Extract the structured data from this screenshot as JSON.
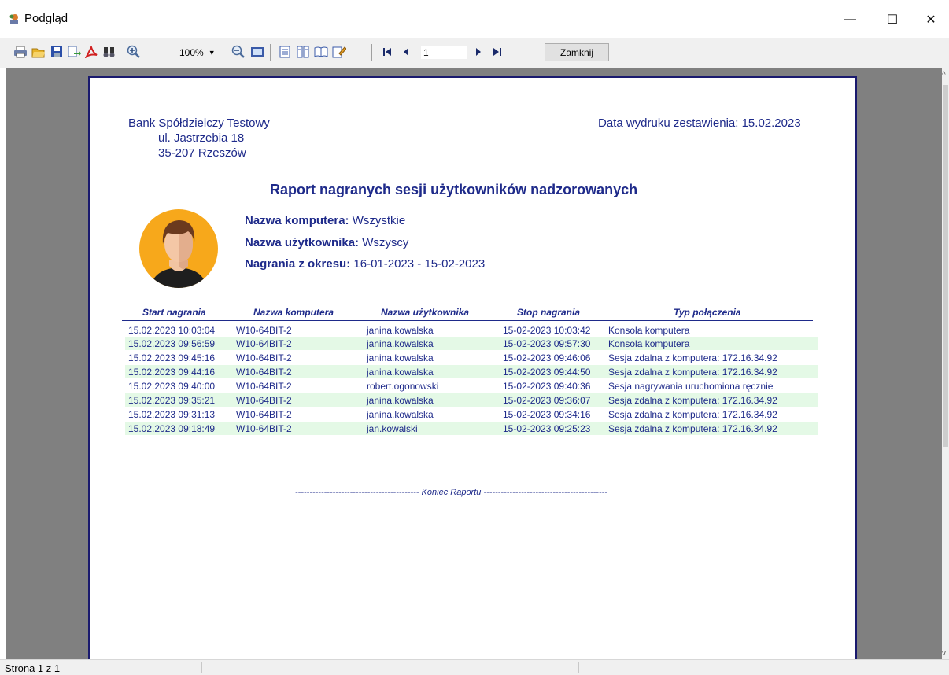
{
  "window": {
    "title": "Podgląd",
    "minimize_glyph": "—",
    "maximize_glyph": "☐",
    "close_glyph": "✕"
  },
  "toolbar": {
    "icons": [
      "print-icon",
      "open-icon",
      "save-icon",
      "export-icon",
      "pdf-icon",
      "find-icon",
      "zoom-in-icon",
      "zoom-out-icon",
      "fit-page-icon",
      "single-page-icon",
      "two-pages-icon",
      "book-view-icon",
      "edit-icon",
      "first-page-icon",
      "prev-page-icon",
      "next-page-icon",
      "last-page-icon"
    ],
    "zoom_value": "100%",
    "page_value": "1",
    "close_label": "Zamknij"
  },
  "report": {
    "bank_name": "Bank Spółdzielczy Testowy",
    "bank_street": "ul. Jastrzebia 18",
    "bank_city": "35-207 Rzeszów",
    "print_date": "Data wydruku zestawienia: 15.02.2023",
    "title": "Raport nagranych sesji użytkowników nadzorowanych",
    "computer_label": "Nazwa komputera:",
    "computer_value": "Wszystkie",
    "user_label": "Nazwa użytkownika:",
    "user_value": "Wszyscy",
    "period_label": "Nagrania z okresu:",
    "period_value": "16-01-2023 - 15-02-2023",
    "columns": [
      "Start nagrania",
      "Nazwa komputera",
      "Nazwa użytkownika",
      "Stop nagrania",
      "Typ połączenia"
    ],
    "rows": [
      [
        "15.02.2023 10:03:04",
        "W10-64BIT-2",
        "janina.kowalska",
        "15-02-2023 10:03:42",
        "Konsola komputera"
      ],
      [
        "15.02.2023 09:56:59",
        "W10-64BIT-2",
        "janina.kowalska",
        "15-02-2023 09:57:30",
        "Konsola komputera"
      ],
      [
        "15.02.2023 09:45:16",
        "W10-64BIT-2",
        "janina.kowalska",
        "15-02-2023 09:46:06",
        "Sesja zdalna z komputera: 172.16.34.92"
      ],
      [
        "15.02.2023 09:44:16",
        "W10-64BIT-2",
        "janina.kowalska",
        "15-02-2023 09:44:50",
        "Sesja zdalna z komputera: 172.16.34.92"
      ],
      [
        "15.02.2023 09:40:00",
        "W10-64BIT-2",
        "robert.ogonowski",
        "15-02-2023 09:40:36",
        "Sesja nagrywania uruchomiona ręcznie"
      ],
      [
        "15.02.2023 09:35:21",
        "W10-64BIT-2",
        "janina.kowalska",
        "15-02-2023 09:36:07",
        "Sesja zdalna z komputera: 172.16.34.92"
      ],
      [
        "15.02.2023 09:31:13",
        "W10-64BIT-2",
        "janina.kowalska",
        "15-02-2023 09:34:16",
        "Sesja zdalna z komputera: 172.16.34.92"
      ],
      [
        "15.02.2023 09:18:49",
        "W10-64BIT-2",
        "jan.kowalski",
        "15-02-2023 09:25:23",
        "Sesja zdalna z komputera: 172.16.34.92"
      ]
    ],
    "end_text": "------------------------------------------- Koniec Raportu -------------------------------------------"
  },
  "status": {
    "page_info": "Strona 1 z 1"
  },
  "colors": {
    "report_text": "#1e2a8a",
    "alt_row": "#e4f9e6",
    "preview_bg": "#808080",
    "avatar_bg": "#f7a81b"
  }
}
